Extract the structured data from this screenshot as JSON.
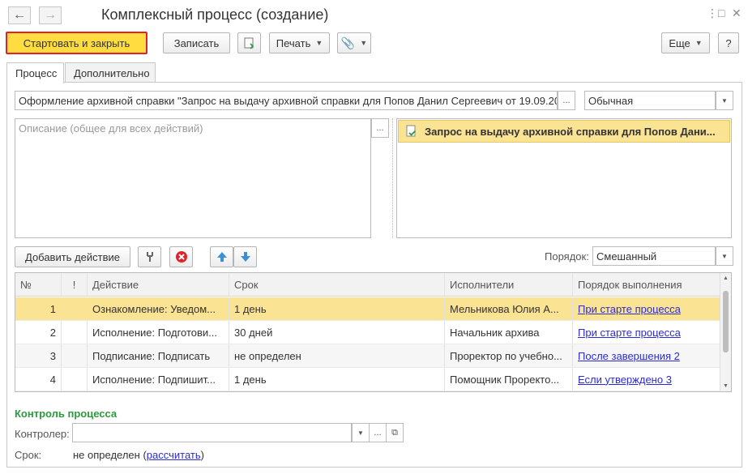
{
  "window": {
    "title": "Комплексный процесс (создание)",
    "controls": [
      "⋮",
      "□",
      "✕"
    ]
  },
  "toolbar": {
    "start_close": "Стартовать и закрыть",
    "save": "Записать",
    "print": "Печать",
    "more": "Еще",
    "help": "?"
  },
  "tabs": [
    "Процесс",
    "Дополнительно"
  ],
  "process": {
    "name": "Оформление архивной справки \"Запрос на выдачу архивной справки для Попов Данил Сергеевич от 19.09.20",
    "importance": "Обычная",
    "description_placeholder": "Описание (общее для всех действий)",
    "attachment": "Запрос на выдачу архивной справки для Попов Дани..."
  },
  "actions_bar": {
    "add_action": "Добавить действие",
    "order_label": "Порядок:",
    "order_value": "Смешанный"
  },
  "table": {
    "headers": [
      "№",
      "!",
      "Действие",
      "Срок",
      "Исполнители",
      "Порядок выполнения"
    ],
    "rows": [
      {
        "n": "1",
        "action": "Ознакомление: Уведом...",
        "term": "1 день",
        "executors": "Мельникова Юлия А...",
        "order": "При старте процесса"
      },
      {
        "n": "2",
        "action": "Исполнение: Подготови...",
        "term": "30 дней",
        "executors": "Начальник архива",
        "order": "При старте процесса"
      },
      {
        "n": "3",
        "action": "Подписание: Подписать",
        "term": "не определен",
        "executors": "Проректор по учебно...",
        "order": "После завершения 2"
      },
      {
        "n": "4",
        "action": "Исполнение: Подпишит...",
        "term": "1 день",
        "executors": "Помощник Проректо...",
        "order": "Если утверждено 3"
      }
    ]
  },
  "control": {
    "heading": "Контроль процесса",
    "controller_label": "Контролер:",
    "controller_value": "",
    "term_label": "Срок:",
    "term_value": "не определен (",
    "term_link": "рассчитать",
    "term_close": ")"
  }
}
